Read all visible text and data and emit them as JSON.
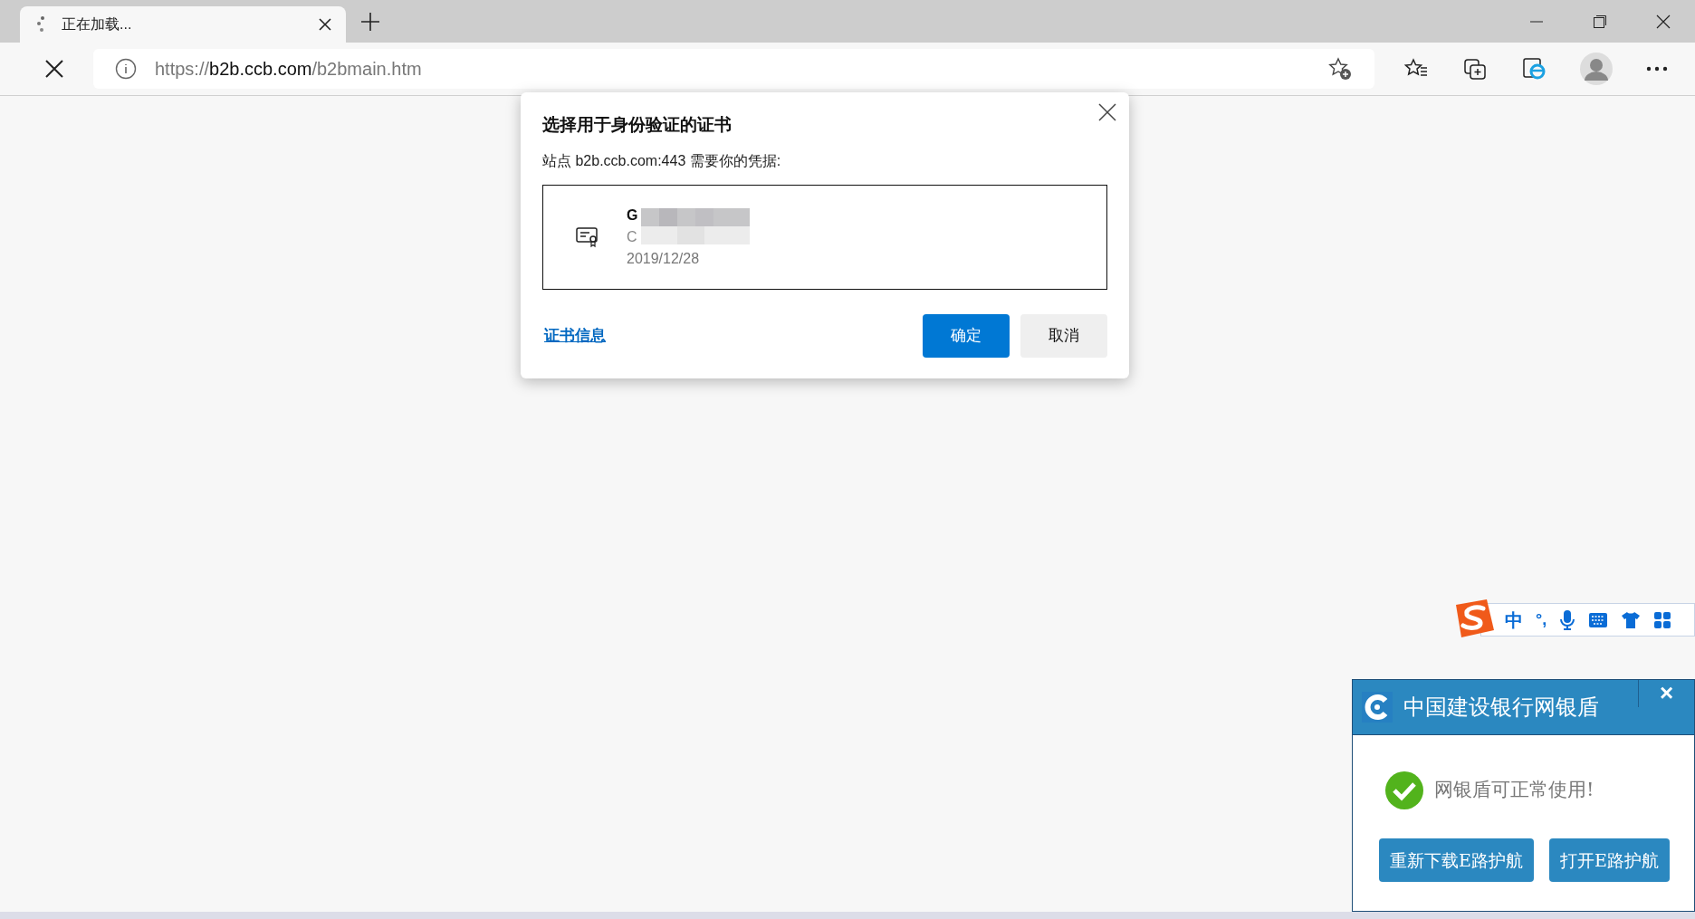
{
  "browser": {
    "tab": {
      "title": "正在加载...",
      "selected": true
    },
    "address": {
      "scheme": "https://",
      "host": "b2b.ccb.com",
      "path": "/b2bmain.htm"
    }
  },
  "dialog": {
    "title": "选择用于身份验证的证书",
    "subtitle": "站点 b2b.ccb.com:443 需要你的凭据:",
    "certificate": {
      "name": "G",
      "issuer": "C",
      "date": "2019/12/28",
      "selected": true
    },
    "link": "证书信息",
    "buttons": [
      {
        "label": "确定",
        "kind": "primary"
      },
      {
        "label": "取消",
        "kind": "secondary"
      }
    ]
  },
  "ime_toolbar": {
    "mode": "中",
    "punctuation": "°,"
  },
  "bank_popup": {
    "title": "中国建设银行网银盾",
    "close": "×",
    "message": "网银盾可正常使用!",
    "buttons": [
      "重新下载E路护航",
      "打开E路护航"
    ]
  }
}
